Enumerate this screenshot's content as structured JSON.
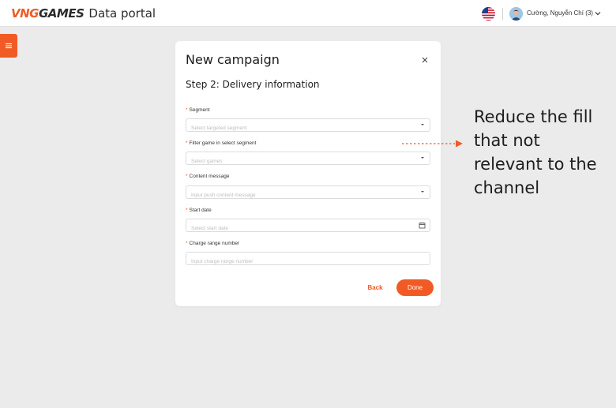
{
  "header": {
    "brand_part1": "VNG",
    "brand_part2": "GAMES",
    "app_title": "Data portal",
    "user_name": "Cường, Nguyễn Chí (3)"
  },
  "modal": {
    "title": "New campaign",
    "step_title": "Step 2: Delivery information",
    "fields": [
      {
        "label": "Segment",
        "placeholder": "Select targeted segment",
        "control": "select"
      },
      {
        "label": "Filter game in select segment",
        "placeholder": "Select games",
        "control": "select"
      },
      {
        "label": "Content message",
        "placeholder": "Input push content message",
        "control": "select"
      },
      {
        "label": "Start date",
        "placeholder": "Select start date",
        "control": "date"
      },
      {
        "label": "Charge range number",
        "placeholder": "Input charge range number",
        "control": "text"
      }
    ],
    "required_marker": "*",
    "back_label": "Back",
    "done_label": "Done"
  },
  "annotation": {
    "text": "Reduce the fill that not relevant to the channel"
  },
  "colors": {
    "accent": "#f15a24",
    "background": "#ebebeb",
    "panel": "#ffffff"
  },
  "icons": [
    "us-flag-icon",
    "avatar",
    "chevron-down-icon",
    "menu-icon",
    "close-icon",
    "caret-down-icon",
    "calendar-icon",
    "arrow-right-icon"
  ]
}
